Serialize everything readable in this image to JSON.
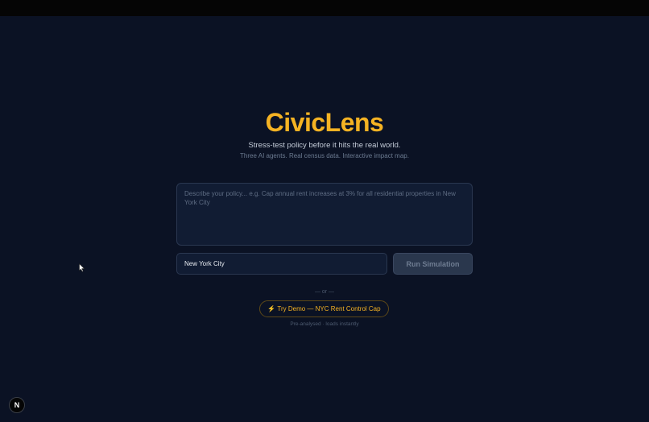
{
  "app": {
    "title": "CivicLens",
    "tagline": "Stress-test policy before it hits the real world.",
    "subtagline": "Three AI agents. Real census data. Interactive impact map."
  },
  "form": {
    "policy_placeholder": "Describe your policy... e.g. Cap annual rent increases at 3% for all residential properties in New York City",
    "city_value": "New York City",
    "run_label": "Run Simulation"
  },
  "demo": {
    "divider": "— or —",
    "icon": "⚡",
    "label": "Try Demo — NYC Rent Control Cap",
    "note": "Pre-analysed · loads instantly"
  },
  "badge": {
    "letter": "N"
  },
  "colors": {
    "background": "#0b1224",
    "accent": "#f5b323",
    "input_bg": "#111c33"
  }
}
